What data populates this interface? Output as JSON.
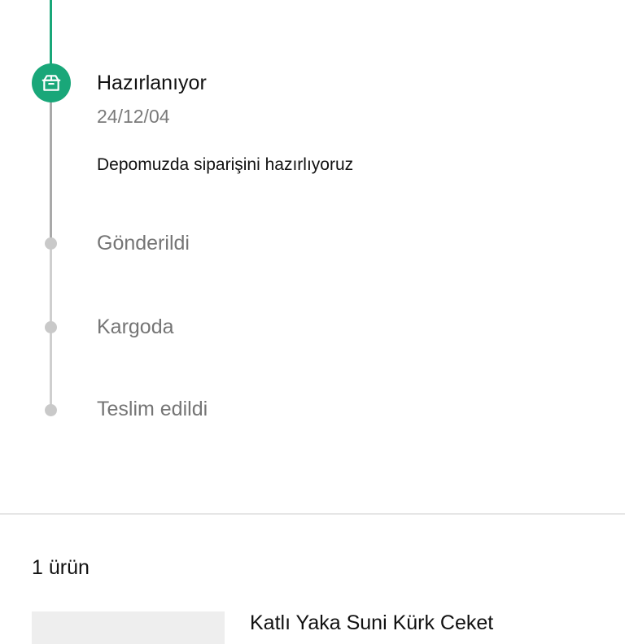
{
  "timeline": {
    "steps": [
      {
        "title": "Hazırlanıyor",
        "date": "24/12/04",
        "description": "Depomuzda siparişini hazırlıyoruz",
        "state": "active",
        "icon": "box-icon"
      },
      {
        "title": "Gönderildi",
        "state": "pending"
      },
      {
        "title": "Kargoda",
        "state": "pending"
      },
      {
        "title": "Teslim edildi",
        "state": "pending"
      }
    ],
    "colors": {
      "active": "#19a779",
      "progress_line": "#a9a9a9",
      "pending": "#c9c9c9"
    }
  },
  "order": {
    "items_count": "1 ürün",
    "product": {
      "name": "Katlı Yaka Suni Kürk Ceket"
    }
  }
}
